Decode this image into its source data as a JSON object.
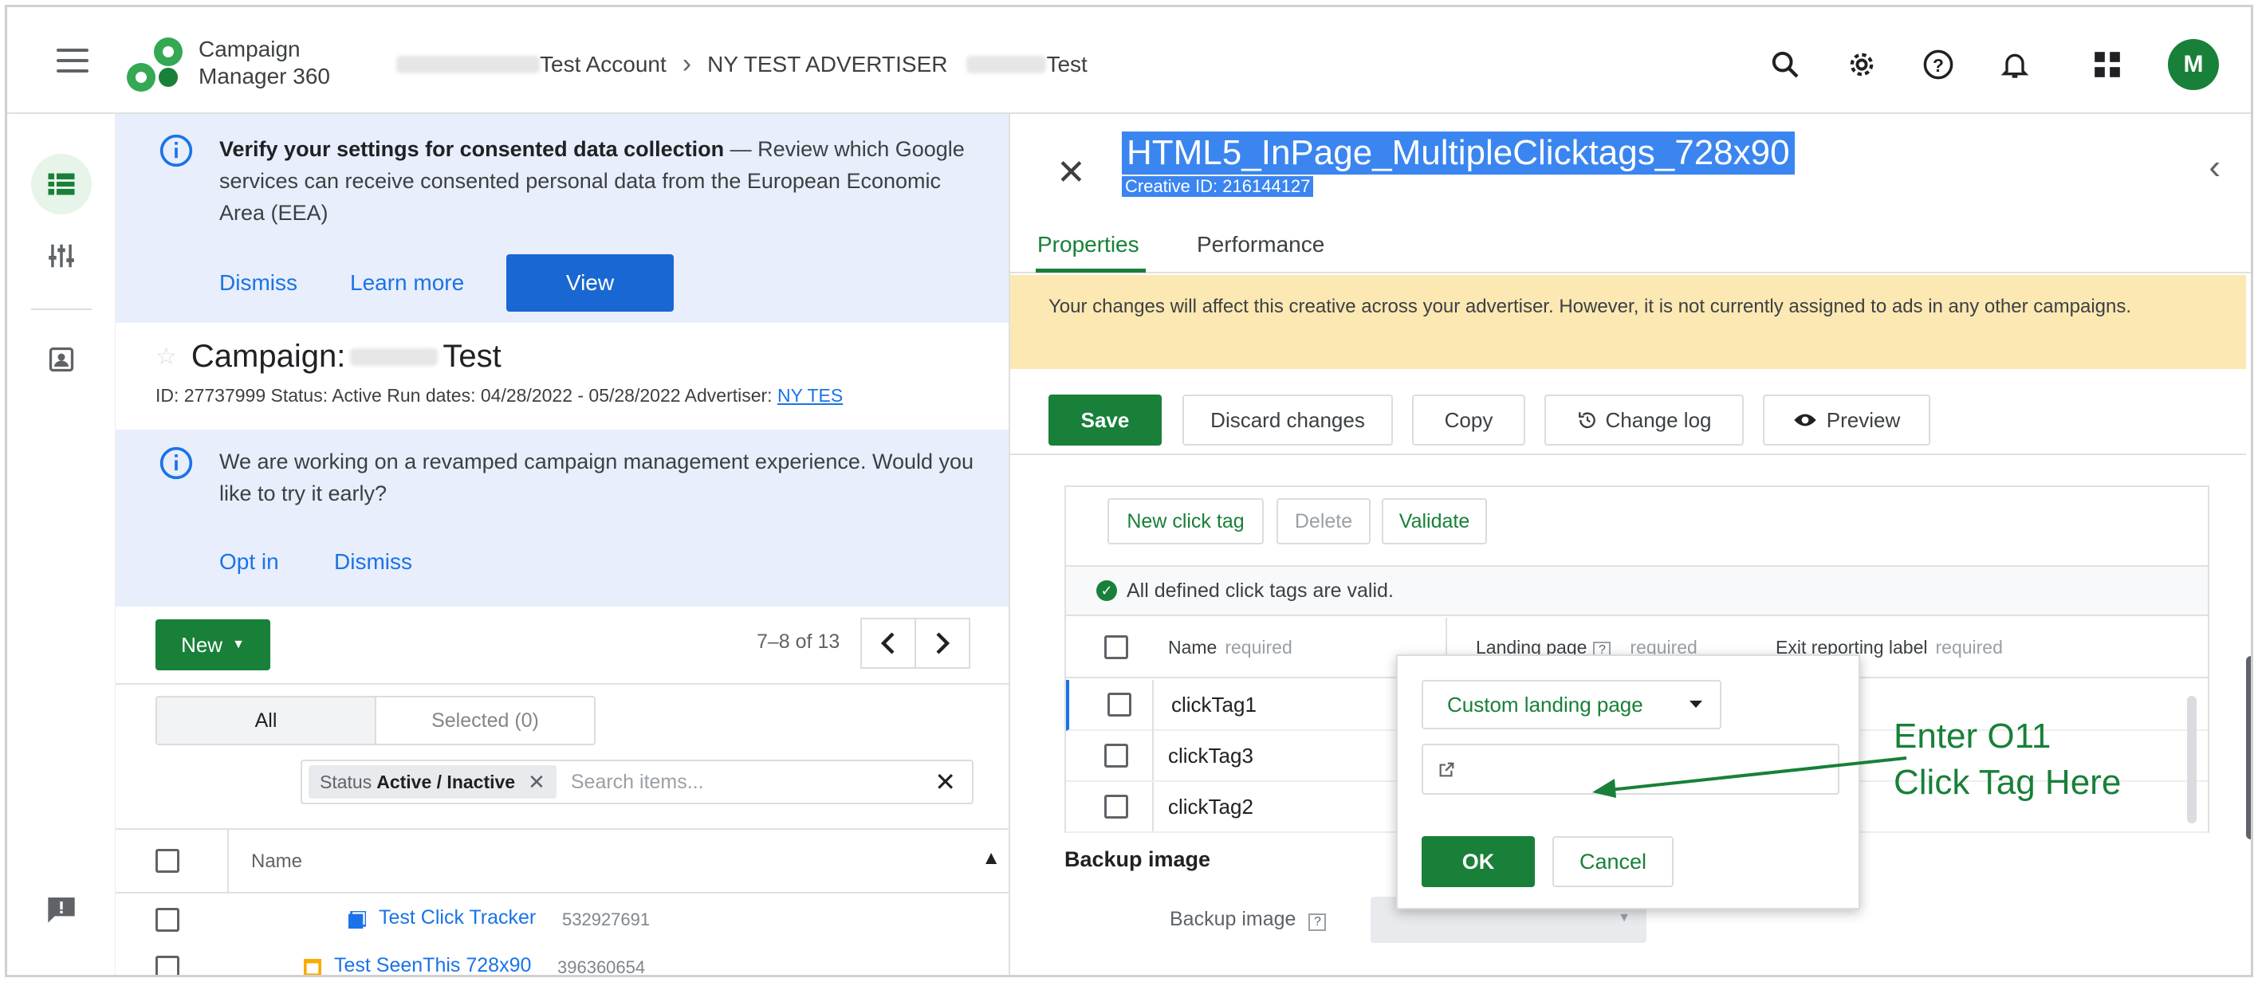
{
  "header": {
    "product_name_line1": "Campaign",
    "product_name_line2": "Manager 360",
    "breadcrumb_account": "Test Account",
    "breadcrumb_advertiser": "NY TEST ADVERTISER",
    "breadcrumb_campaign": "Test",
    "avatar_letter": "M"
  },
  "consent_banner": {
    "title": "Verify your settings for consented data collection",
    "body": " — Review which Google services can receive consented personal data from the European Economic Area (EEA)",
    "dismiss": "Dismiss",
    "learn_more": "Learn more",
    "view": "View"
  },
  "campaign": {
    "title_prefix": "Campaign:",
    "title_suffix": "Test",
    "meta": "ID: 27737999  Status: Active  Run dates: 04/28/2022 - 05/28/2022  Advertiser: ",
    "advertiser_link": "NY TES"
  },
  "revamp_banner": {
    "body": "We are working on a revamped campaign management experience. Would you like to try it early?",
    "opt_in": "Opt in",
    "dismiss": "Dismiss"
  },
  "list": {
    "new_button": "New",
    "pager_text": "7–8 of 13",
    "seg_all": "All",
    "seg_selected": "Selected (0)",
    "filter_label": "Status",
    "filter_value": "Active / Inactive",
    "search_placeholder": "Search items...",
    "column_name": "Name",
    "rows": [
      {
        "name": "Test Click Tracker",
        "id": "532927691"
      },
      {
        "name": "Test SeenThis 728x90",
        "id": "396360654"
      }
    ]
  },
  "creative": {
    "title": "HTML5_InPage_MultipleClicktags_728x90",
    "id_label": "Creative ID:",
    "id_value": "216144127",
    "tabs": [
      "Properties",
      "Performance"
    ],
    "warning": "Your changes will affect this creative across your advertiser. However, it is not currently assigned to ads in any other campaigns.",
    "actions": {
      "save": "Save",
      "discard": "Discard changes",
      "copy": "Copy",
      "change_log": "Change log",
      "preview": "Preview"
    },
    "clicktags": {
      "new": "New click tag",
      "delete": "Delete",
      "validate": "Validate",
      "valid_msg": "All defined click tags are valid.",
      "col_name": "Name",
      "col_landing": "Landing page",
      "col_exit": "Exit reporting label",
      "required": "required",
      "rows": [
        "clickTag1",
        "clickTag3",
        "clickTag2"
      ]
    },
    "backup_title": "Backup image",
    "backup_label": "Backup image"
  },
  "popup": {
    "dropdown_value": "Custom landing page",
    "ok": "OK",
    "cancel": "Cancel"
  },
  "annotation": {
    "line1": "Enter O11",
    "line2": "Click Tag Here"
  },
  "colors": {
    "accent_green": "#188038",
    "link_blue": "#1a73e8",
    "banner_bg": "#e8eefb",
    "warning_bg": "#fce8b2",
    "highlight": "#3a85f0"
  }
}
